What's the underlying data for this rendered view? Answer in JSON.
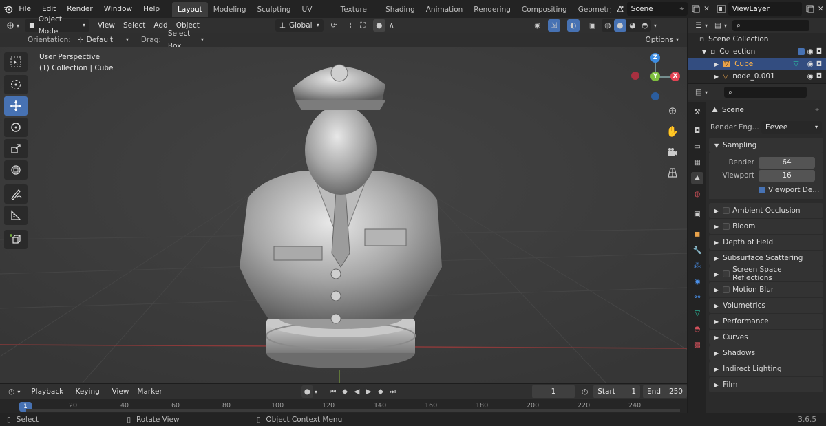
{
  "topbar": {
    "menus": [
      "File",
      "Edit",
      "Render",
      "Window",
      "Help"
    ],
    "workspaces": [
      "Layout",
      "Modeling",
      "Sculpting",
      "UV Editing",
      "Texture Paint",
      "Shading",
      "Animation",
      "Rendering",
      "Compositing",
      "Geometry Noc"
    ],
    "scene": "Scene",
    "view_layer": "ViewLayer"
  },
  "viewport_header": {
    "mode": "Object Mode",
    "menus": [
      "View",
      "Select",
      "Add",
      "Object"
    ],
    "transform": "Global",
    "orientation_label": "Orientation:",
    "orientation_value": "Default",
    "drag_label": "Drag:",
    "drag_value": "Select Box",
    "options": "Options"
  },
  "viewport": {
    "perspective": "User Perspective",
    "collection": "(1) Collection | Cube",
    "axes": {
      "z": "Z",
      "x": "X",
      "y": "Y"
    }
  },
  "outliner": {
    "scene_collection": "Scene Collection",
    "collection": "Collection",
    "items": [
      "Cube",
      "node_0.001"
    ]
  },
  "properties": {
    "context": "Scene",
    "render_engine_label": "Render Eng...",
    "render_engine": "Eevee",
    "sampling": "Sampling",
    "render_label": "Render",
    "render_value": "64",
    "viewport_label": "Viewport",
    "viewport_value": "16",
    "viewport_denoise": "Viewport De...",
    "panels": [
      {
        "label": "Ambient Occlusion",
        "checkbox": true
      },
      {
        "label": "Bloom",
        "checkbox": true
      },
      {
        "label": "Depth of Field",
        "checkbox": false
      },
      {
        "label": "Subsurface Scattering",
        "checkbox": false
      },
      {
        "label": "Screen Space Reflections",
        "checkbox": true
      },
      {
        "label": "Motion Blur",
        "checkbox": true
      },
      {
        "label": "Volumetrics",
        "checkbox": false
      },
      {
        "label": "Performance",
        "checkbox": false
      },
      {
        "label": "Curves",
        "checkbox": false
      },
      {
        "label": "Shadows",
        "checkbox": false
      },
      {
        "label": "Indirect Lighting",
        "checkbox": false
      },
      {
        "label": "Film",
        "checkbox": false
      }
    ]
  },
  "timeline": {
    "menus": [
      "Playback",
      "Keying",
      "View",
      "Marker"
    ],
    "current_frame": "1",
    "start_label": "Start",
    "start": "1",
    "end_label": "End",
    "end": "250",
    "ticks": [
      "20",
      "40",
      "60",
      "80",
      "100",
      "120",
      "140",
      "160",
      "180",
      "200",
      "220",
      "240"
    ],
    "playhead": "1"
  },
  "statusbar": {
    "select": "Select",
    "rotate": "Rotate View",
    "context_menu": "Object Context Menu",
    "version": "3.6.5"
  },
  "colors": {
    "accent": "#4772b3",
    "selected_text": "#ffb44a",
    "x_axis": "#e34353",
    "y_axis": "#7fbf3f",
    "z_axis": "#3d8de3"
  }
}
